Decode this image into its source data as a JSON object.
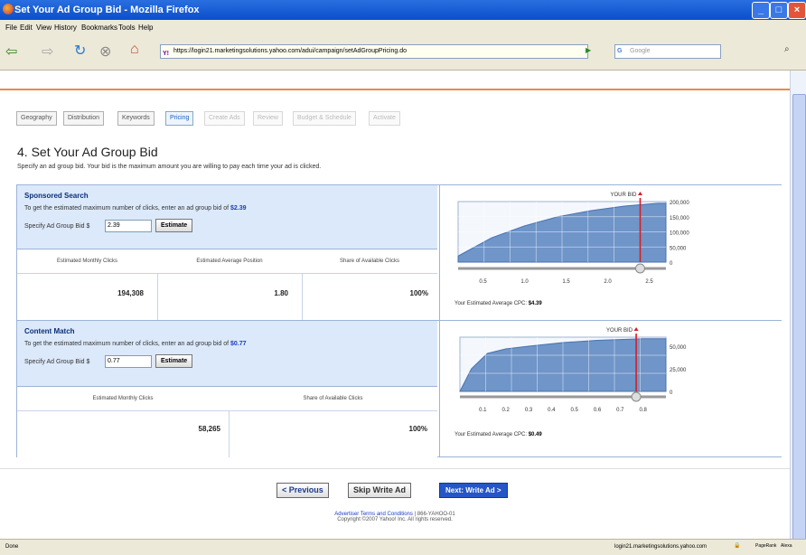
{
  "window": {
    "title": "Set Your Ad Group Bid - Mozilla Firefox"
  },
  "menu": [
    "File",
    "Edit",
    "View",
    "History",
    "Bookmarks",
    "Tools",
    "Help"
  ],
  "toolbar": {
    "url": "https://login21.marketingsolutions.yahoo.com/adui/campaign/setAdGroupPricing.do",
    "search_placeholder": "Google"
  },
  "breadcrumb": [
    {
      "label": "Geography",
      "state": "done"
    },
    {
      "label": "Distribution",
      "state": "done"
    },
    {
      "label": "Keywords",
      "state": "done"
    },
    {
      "label": "Pricing",
      "state": "active"
    },
    {
      "label": "Create Ads",
      "state": "disabled"
    },
    {
      "label": "Review",
      "state": "disabled"
    },
    {
      "label": "Budget & Schedule",
      "state": "disabled"
    },
    {
      "label": "Activate",
      "state": "disabled"
    }
  ],
  "page": {
    "heading": "4. Set Your Ad Group Bid",
    "subheading": "Specify an ad group bid. Your bid is the maximum amount you are willing to pay each time your ad is clicked."
  },
  "sponsored": {
    "title": "Sponsored Search",
    "hint_prefix": "To get the estimated maximum number of clicks, enter an ad group bid of",
    "hint_value": "$2.39",
    "bid_label": "Specify Ad Group Bid $",
    "bid_value": "2.39",
    "estimate_label": "Estimate",
    "columns": [
      "Estimated Monthly Clicks",
      "Estimated Average Position",
      "Share of Available Clicks"
    ],
    "values": [
      "194,308",
      "1.80",
      "100%"
    ],
    "your_bid_label": "YOUR BID",
    "cpc_label": "Your Estimated Average CPC:",
    "cpc_value": "$4.39"
  },
  "content_match": {
    "title": "Content Match",
    "hint_prefix": "To get the estimated maximum number of clicks, enter an ad group bid of",
    "hint_value": "$0.77",
    "bid_label": "Specify Ad Group Bid $",
    "bid_value": "0.77",
    "estimate_label": "Estimate",
    "columns": [
      "Estimated Monthly Clicks",
      "Share of Available Clicks"
    ],
    "values": [
      "58,265",
      "100%"
    ],
    "your_bid_label": "YOUR BID",
    "cpc_label": "Your Estimated Average CPC:",
    "cpc_value": "$0.49"
  },
  "chart_data": [
    {
      "type": "area",
      "x": [
        0.5,
        1.0,
        1.5,
        2.0,
        2.5
      ],
      "x_ticks": [
        "0.5",
        "1.0",
        "1.5",
        "2.0",
        "2.5"
      ],
      "y_ticks": [
        "200,000",
        "150,000",
        "100,000",
        "50,000",
        "0"
      ],
      "ylim": [
        0,
        200000
      ],
      "curve": [
        [
          0.2,
          20000
        ],
        [
          0.6,
          80000
        ],
        [
          1.0,
          120000
        ],
        [
          1.4,
          150000
        ],
        [
          1.8,
          170000
        ],
        [
          2.2,
          185000
        ],
        [
          2.6,
          194308
        ]
      ],
      "bid": 2.39,
      "bid_label": "YOUR BID"
    },
    {
      "type": "area",
      "x": [
        0.1,
        0.2,
        0.3,
        0.4,
        0.5,
        0.6,
        0.7,
        0.8
      ],
      "x_ticks": [
        "0.1",
        "0.2",
        "0.3",
        "0.4",
        "0.5",
        "0.6",
        "0.7",
        "0.8"
      ],
      "y_ticks": [
        "50,000",
        "25,000",
        "0"
      ],
      "ylim": [
        0,
        60000
      ],
      "curve": [
        [
          0.05,
          25000
        ],
        [
          0.12,
          42000
        ],
        [
          0.2,
          47000
        ],
        [
          0.3,
          50000
        ],
        [
          0.45,
          54000
        ],
        [
          0.6,
          56500
        ],
        [
          0.8,
          58265
        ]
      ],
      "bid": 0.77,
      "bid_label": "YOUR BID"
    }
  ],
  "buttons": {
    "previous": "< Previous",
    "skip": "Skip Write Ad",
    "next": "Next: Write Ad >"
  },
  "footer": {
    "terms": "Advertiser Terms and Conditions",
    "phone": "| 866-YAHOO-01",
    "copyright": "Copyright ©2007 Yahoo! Inc. All rights reserved."
  },
  "status": {
    "left": "Done",
    "right": "login21.marketingsolutions.yahoo.com",
    "pagerank": "PageRank",
    "alexa": "Alexa"
  }
}
